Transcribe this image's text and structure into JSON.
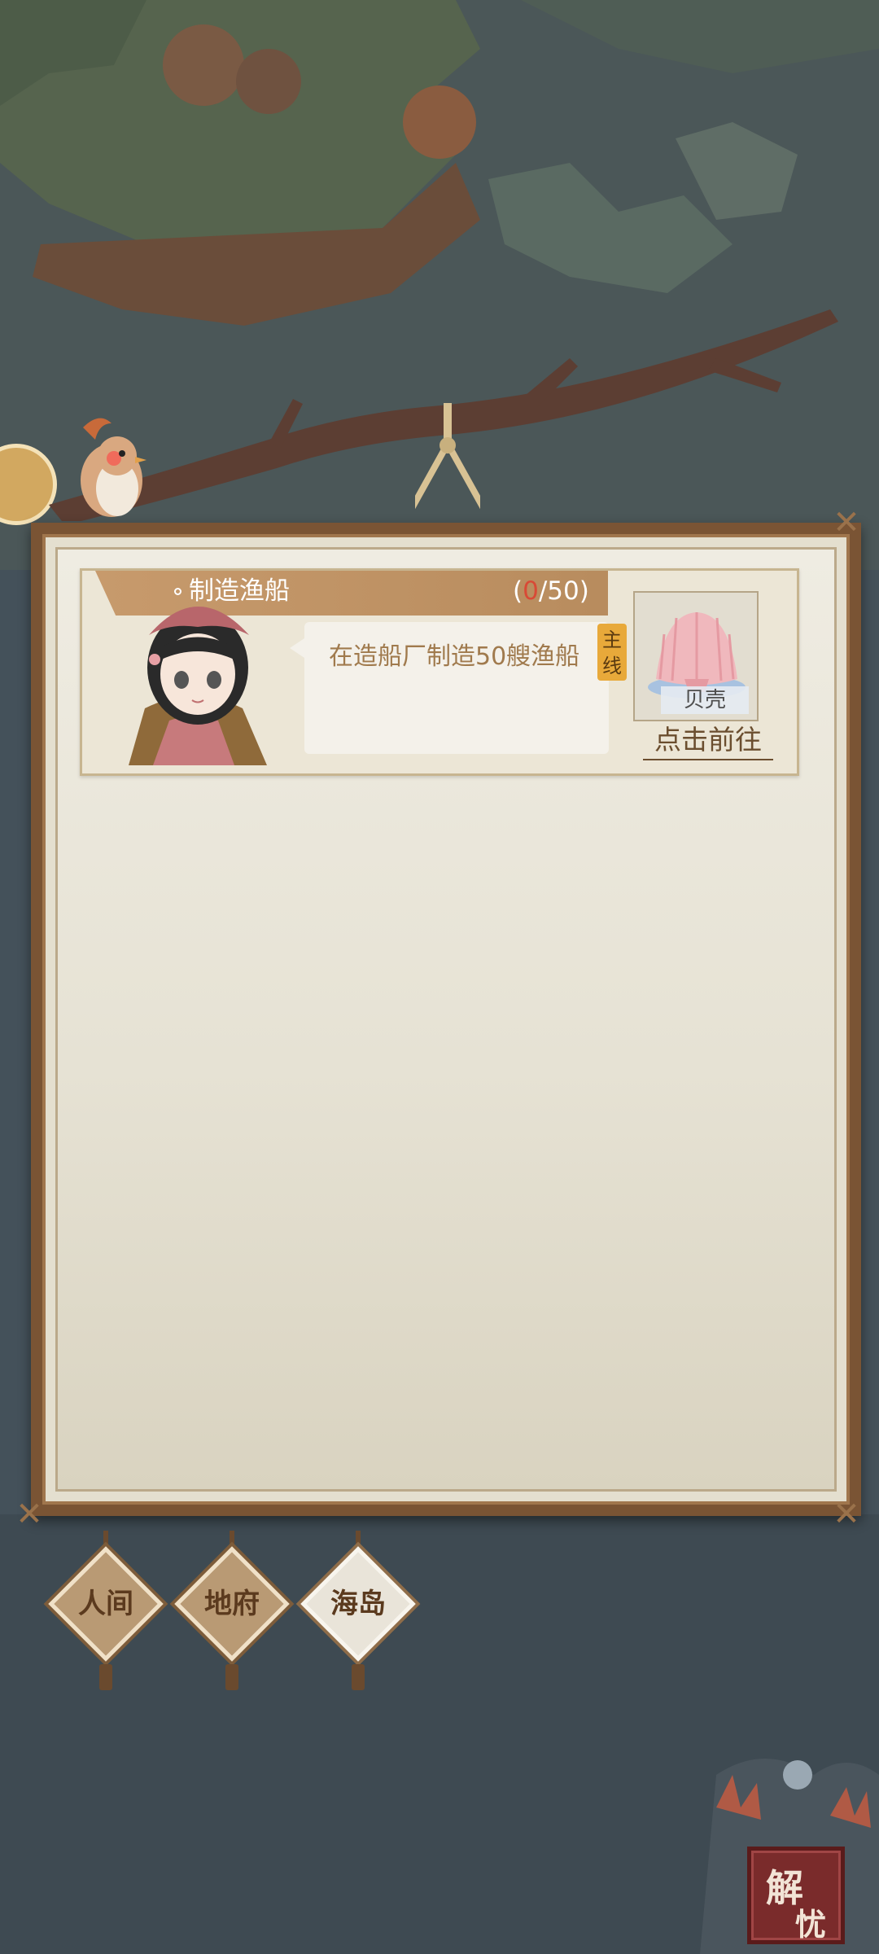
{
  "quest": {
    "title": "制造渔船",
    "progress_current": "0",
    "progress_total": "/50)",
    "progress_open": "(",
    "description": "在造船厂制造50艘渔船",
    "tag": "主线",
    "reward_label": "贝壳",
    "goto_label": "点击前往"
  },
  "tabs": [
    {
      "label": "人间",
      "active": false
    },
    {
      "label": "地府",
      "active": false
    },
    {
      "label": "海岛",
      "active": true
    }
  ],
  "seal": {
    "char1": "解",
    "char2": "忧"
  },
  "colors": {
    "frame": "#7a5434",
    "header": "#c79a6c",
    "progress_current": "#d84a36",
    "tag": "#e8a93a",
    "seal": "#7a2b2b"
  }
}
